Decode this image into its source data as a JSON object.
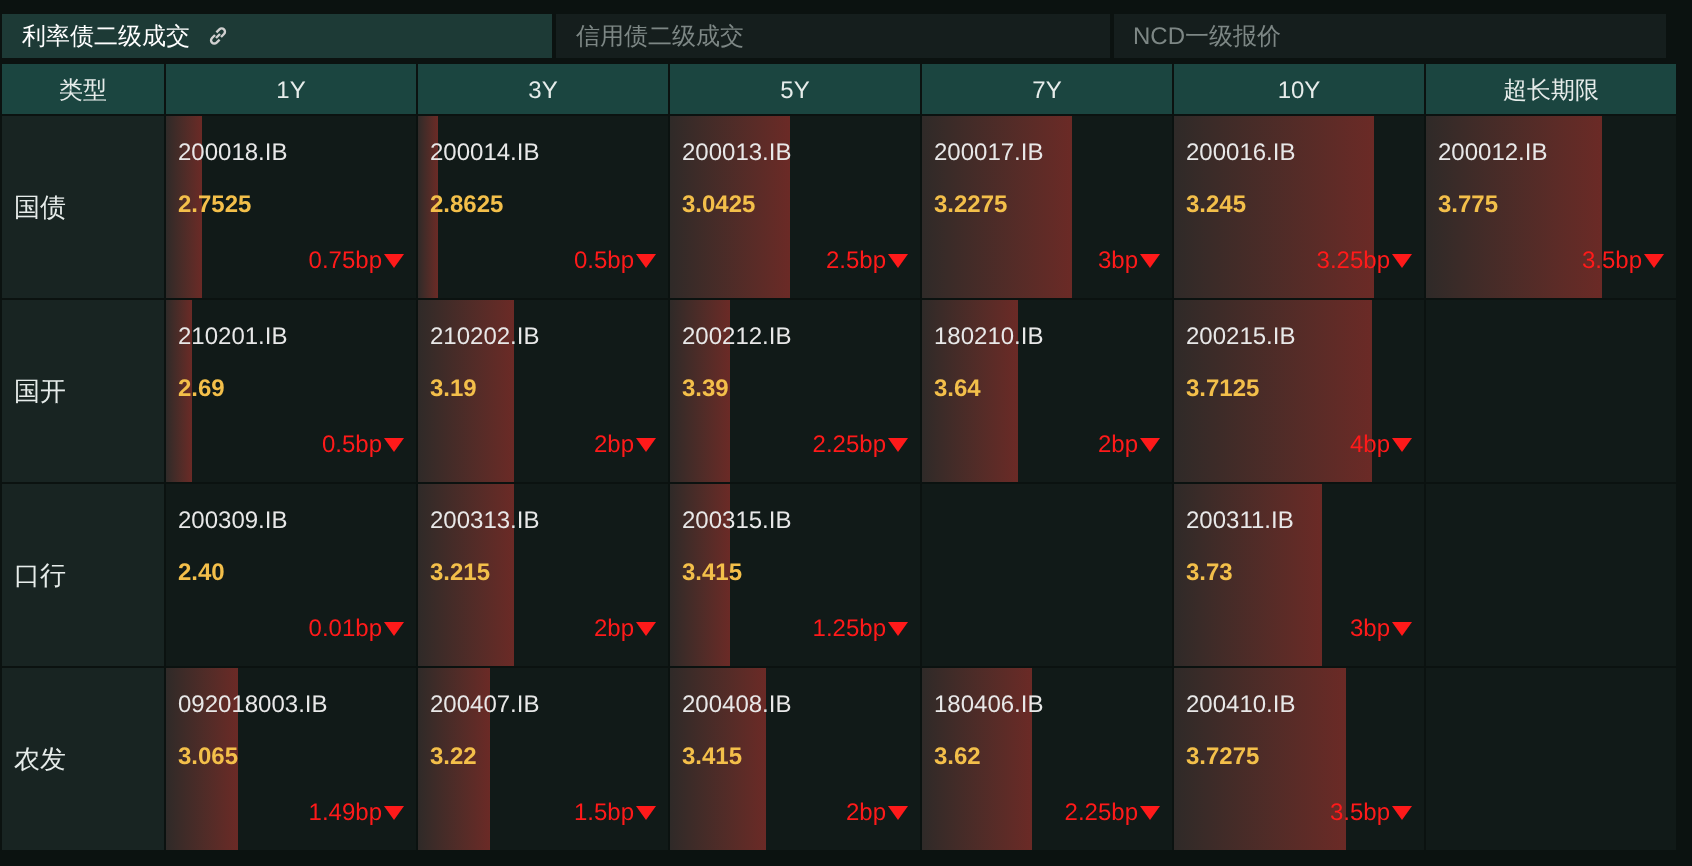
{
  "tabs": [
    {
      "label": "利率债二级成交",
      "selected": true
    },
    {
      "label": "信用债二级成交",
      "selected": false
    },
    {
      "label": "NCD一级报价",
      "selected": false
    }
  ],
  "table": {
    "columns": [
      "类型",
      "1Y",
      "3Y",
      "5Y",
      "7Y",
      "10Y",
      "超长期限"
    ],
    "rows": [
      {
        "cells": [
          {
            "kind": "category",
            "text": "国债"
          },
          {
            "kind": "quote",
            "code": "200018.IB",
            "rate": "2.7525",
            "change": "0.75bp",
            "level": 0.14
          },
          {
            "kind": "quote",
            "code": "200014.IB",
            "rate": "2.8625",
            "change": "0.5bp",
            "level": 0.08
          },
          {
            "kind": "quote",
            "code": "200013.IB",
            "rate": "3.0425",
            "change": "2.5bp",
            "level": 0.48
          },
          {
            "kind": "quote",
            "code": "200017.IB",
            "rate": "3.2275",
            "change": "3bp",
            "level": 0.6
          },
          {
            "kind": "quote",
            "code": "200016.IB",
            "rate": "3.245",
            "change": "3.25bp",
            "level": 0.8
          },
          {
            "kind": "quote",
            "code": "200012.IB",
            "rate": "3.775",
            "change": "3.5bp",
            "level": 0.7
          }
        ]
      },
      {
        "cells": [
          {
            "kind": "category",
            "text": "国开"
          },
          {
            "kind": "quote",
            "code": "210201.IB",
            "rate": "2.69",
            "change": "0.5bp",
            "level": 0.1
          },
          {
            "kind": "quote",
            "code": "210202.IB",
            "rate": "3.19",
            "change": "2bp",
            "level": 0.38
          },
          {
            "kind": "quote",
            "code": "200212.IB",
            "rate": "3.39",
            "change": "2.25bp",
            "level": 0.24
          },
          {
            "kind": "quote",
            "code": "180210.IB",
            "rate": "3.64",
            "change": "2bp",
            "level": 0.38
          },
          {
            "kind": "quote",
            "code": "200215.IB",
            "rate": "3.7125",
            "change": "4bp",
            "level": 0.79
          },
          ""
        ]
      },
      {
        "cells": [
          {
            "kind": "category",
            "text": "口行"
          },
          {
            "kind": "quote",
            "code": "200309.IB",
            "rate": "2.40",
            "change": "0.01bp"
          },
          {
            "kind": "quote",
            "code": "200313.IB",
            "rate": "3.215",
            "change": "2bp",
            "level": 0.38
          },
          {
            "kind": "quote",
            "code": "200315.IB",
            "rate": "3.415",
            "change": "1.25bp",
            "level": 0.24
          },
          "",
          {
            "kind": "quote",
            "code": "200311.IB",
            "rate": "3.73",
            "change": "3bp",
            "level": 0.59
          },
          ""
        ]
      },
      {
        "cells": [
          {
            "kind": "category",
            "text": "农发"
          },
          {
            "kind": "quote",
            "code": "092018003.IB",
            "rate": "3.065",
            "change": "1.49bp",
            "level": 0.29
          },
          {
            "kind": "quote",
            "code": "200407.IB",
            "rate": "3.22",
            "change": "1.5bp",
            "level": 0.29
          },
          {
            "kind": "quote",
            "code": "200408.IB",
            "rate": "3.415",
            "change": "2bp",
            "level": 0.38
          },
          {
            "kind": "quote",
            "code": "180406.IB",
            "rate": "3.62",
            "change": "2.25bp",
            "level": 0.44
          },
          {
            "kind": "quote",
            "code": "200410.IB",
            "rate": "3.7275",
            "change": "3.5bp",
            "level": 0.69
          },
          ""
        ]
      }
    ]
  }
}
